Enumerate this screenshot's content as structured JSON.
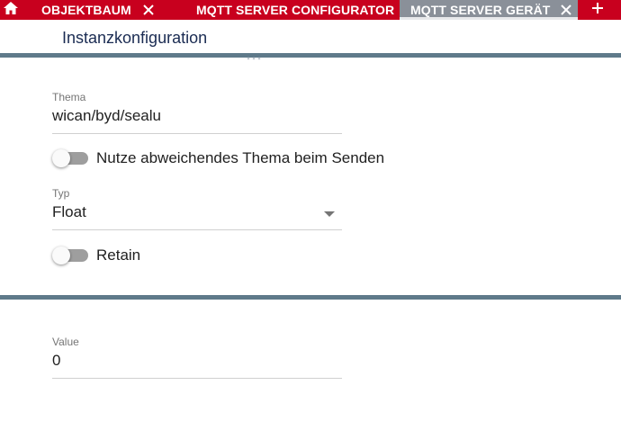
{
  "tabs": [
    {
      "label": "OBJEKTBAUM",
      "active": false
    },
    {
      "label": "MQTT SERVER CONFIGURATOR",
      "active": false
    },
    {
      "label": "MQTT SERVER GERÄT",
      "active": true
    }
  ],
  "icons": {
    "home": "home-icon",
    "close": "close-icon",
    "add": "plus-icon"
  },
  "colors": {
    "tabbar": "#c8001e",
    "active_tab": "#8a9099",
    "divider": "#5f7a8a",
    "title": "#1a2b52"
  },
  "section": {
    "title": "Instanzkonfiguration"
  },
  "form": {
    "topic": {
      "label": "Thema",
      "value": "wican/byd/sealu"
    },
    "alt_topic_toggle": {
      "label": "Nutze abweichendes Thema beim Senden",
      "checked": false
    },
    "type": {
      "label": "Typ",
      "value": "Float"
    },
    "retain_toggle": {
      "label": "Retain",
      "checked": false
    },
    "value": {
      "label": "Value",
      "value": "0"
    }
  }
}
